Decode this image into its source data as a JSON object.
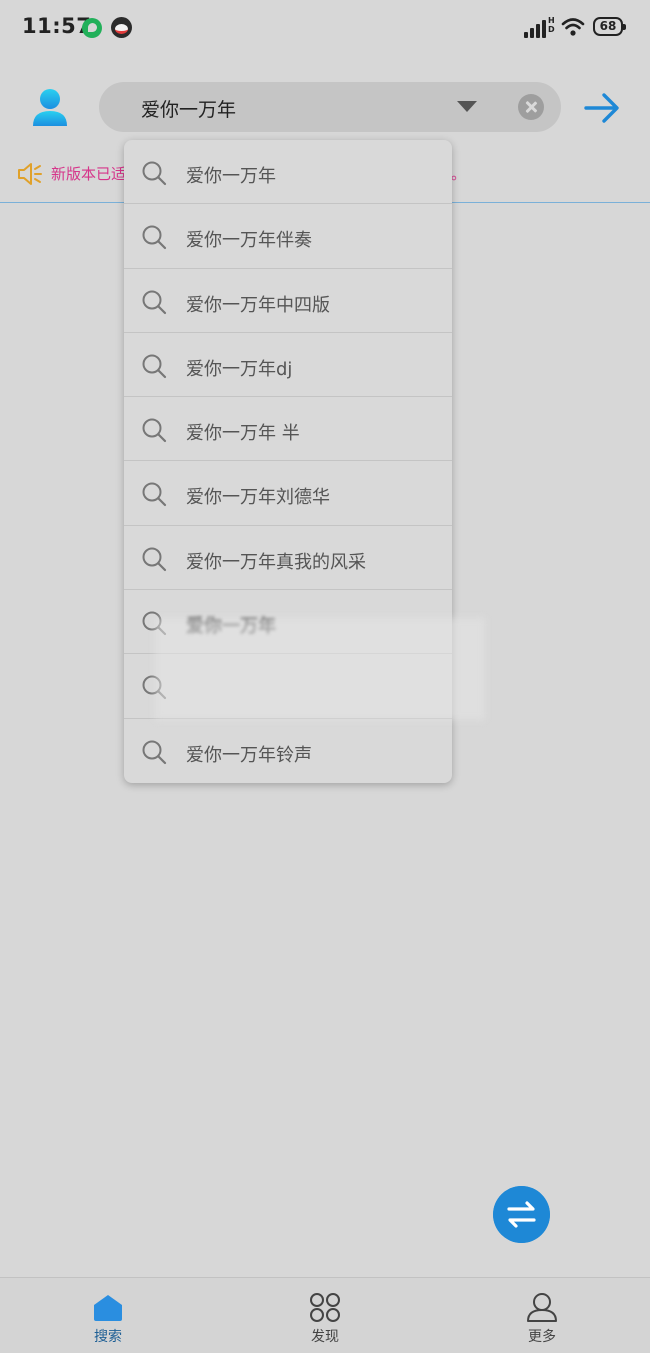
{
  "status_bar": {
    "time": "11:57",
    "network": "HD",
    "battery": "68",
    "icons": [
      "chat-app-icon",
      "qq-icon",
      "signal-icon",
      "wifi-icon",
      "battery-icon"
    ]
  },
  "header": {
    "search_value": "爱你一万年",
    "icons": [
      "avatar-icon",
      "dropdown-arrow-icon",
      "clear-icon",
      "arrow-right-icon"
    ]
  },
  "notice": {
    "text_start": "新版本已适",
    "text_end": "。"
  },
  "suggestions": [
    {
      "label": "爱你一万年",
      "blurred": false
    },
    {
      "label": "爱你一万年伴奏",
      "blurred": false
    },
    {
      "label": "爱你一万年中四版",
      "blurred": false
    },
    {
      "label": "爱你一万年dj",
      "blurred": false
    },
    {
      "label": "爱你一万年 半",
      "blurred": false
    },
    {
      "label": "爱你一万年刘德华",
      "blurred": false
    },
    {
      "label": "爱你一万年真我的风采",
      "blurred": false
    },
    {
      "label": "爱你一万年",
      "blurred": true
    },
    {
      "label": "",
      "blurred": true
    },
    {
      "label": "爱你一万年铃声",
      "blurred": false
    }
  ],
  "fab": {
    "icon": "swap-icon"
  },
  "bottom_nav": {
    "items": [
      {
        "label": "搜索",
        "icon": "home-icon",
        "active": true
      },
      {
        "label": "发现",
        "icon": "grid-icon",
        "active": false
      },
      {
        "label": "更多",
        "icon": "person-icon",
        "active": false
      }
    ]
  },
  "colors": {
    "accent": "#1e88d6",
    "notice": "#d6348a",
    "background": "#d7d7d7"
  }
}
